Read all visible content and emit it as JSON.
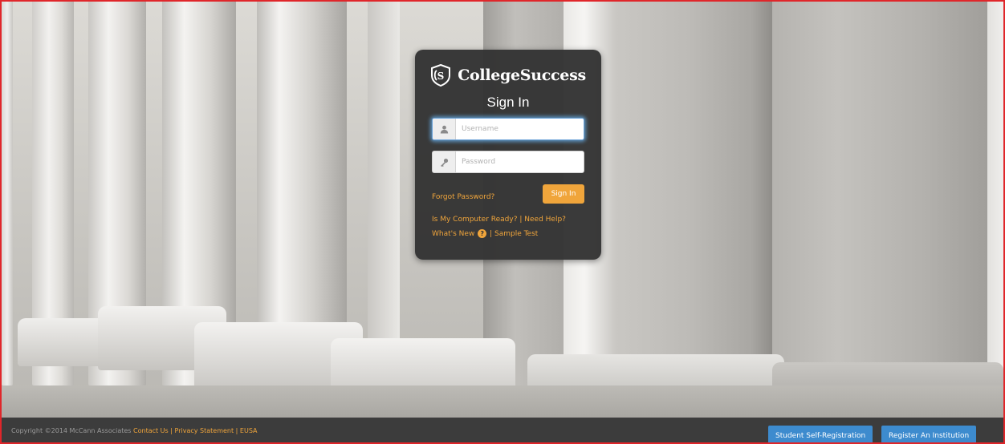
{
  "brand": {
    "name": "CollegeSuccess"
  },
  "login": {
    "title": "Sign In",
    "username_placeholder": "Username",
    "password_placeholder": "Password",
    "forgot_password": "Forgot Password?",
    "signin_button": "Sign In",
    "computer_ready": "Is My Computer Ready?",
    "need_help": "Need Help?",
    "whats_new": "What's New",
    "sample_test": "Sample Test",
    "separator": "|"
  },
  "footer": {
    "copyright": "Copyright ©2014 McCann Associates",
    "contact_us": "Contact Us",
    "privacy_statement": "Privacy Statement",
    "eusa": "EUSA",
    "separator": "|",
    "student_registration": "Student Self-Registration",
    "register_institution": "Register An Institution"
  },
  "icons": {
    "username": "user-icon",
    "password": "key-icon",
    "whats_new": "question-circle-icon",
    "logo": "cs-shield-icon"
  },
  "colors": {
    "accent": "#f0a53b",
    "card_bg": "#343434",
    "footer_bg": "#3c3c3c",
    "button_blue": "#3d8bce",
    "frame_border": "#e0262a"
  }
}
